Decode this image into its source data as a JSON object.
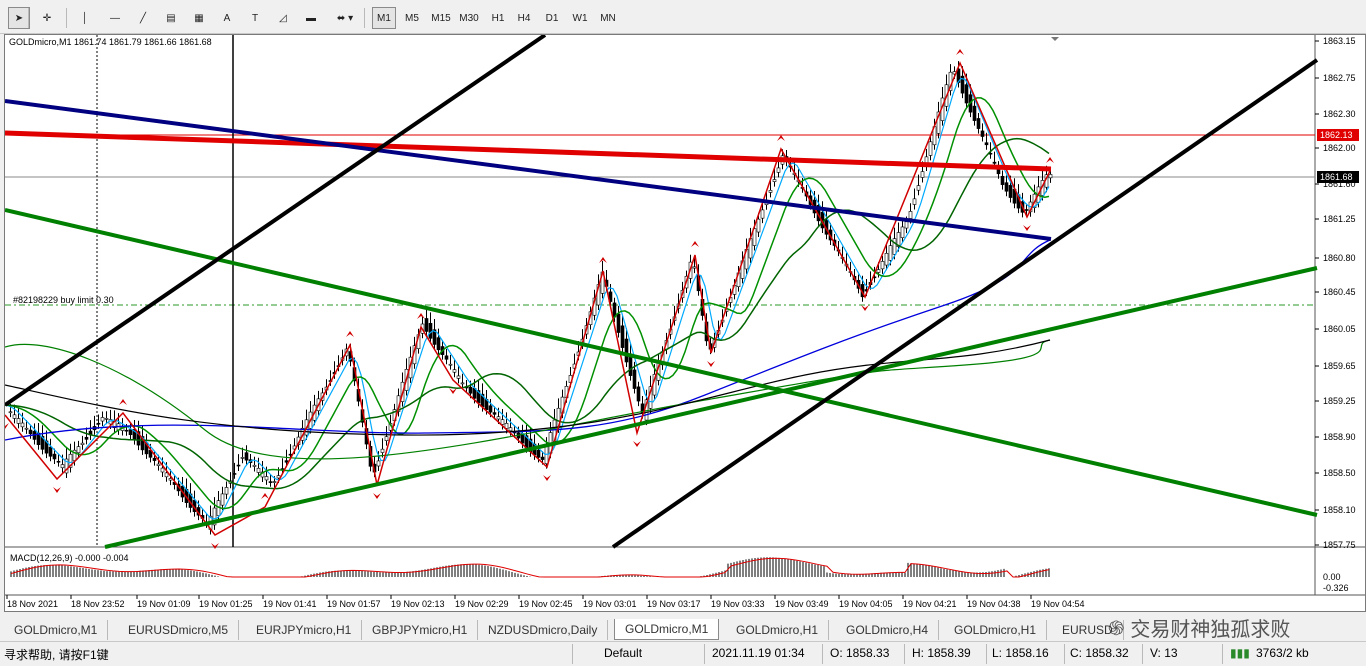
{
  "toolbar": {
    "tools": [
      {
        "name": "cursor-icon",
        "glyph": "➤"
      },
      {
        "name": "crosshair-icon",
        "glyph": "✛"
      },
      {
        "name": "vertical-line-icon",
        "glyph": "│"
      },
      {
        "name": "horizontal-line-icon",
        "glyph": "—"
      },
      {
        "name": "trendline-icon",
        "glyph": "╱"
      },
      {
        "name": "fibonacci-icon",
        "glyph": "▤"
      },
      {
        "name": "grid-tool-icon",
        "glyph": "▦"
      },
      {
        "name": "text-icon",
        "glyph": "A"
      },
      {
        "name": "text-label-icon",
        "glyph": "T"
      },
      {
        "name": "shapes-icon",
        "glyph": "◿"
      },
      {
        "name": "rectangle-icon",
        "glyph": "▬"
      },
      {
        "name": "arrows-icon",
        "glyph": "⬌"
      }
    ],
    "timeframes": [
      "M1",
      "M5",
      "M15",
      "M30",
      "H1",
      "H4",
      "D1",
      "W1",
      "MN"
    ],
    "active_timeframe": "M1"
  },
  "chart": {
    "header": "GOLDmicro,M1  1861.74 1861.79 1861.66 1861.68",
    "order_label": "#82198229 buy limit 0.30",
    "macd_label": "MACD(12,26,9) -0.000 -0.004",
    "price_axis": [
      "1863.15",
      "1862.75",
      "1862.30",
      "1862.00",
      "1861.60",
      "1861.25",
      "1860.80",
      "1860.45",
      "1860.05",
      "1859.65",
      "1859.25",
      "1858.90",
      "1858.50",
      "1858.10",
      "1857.75"
    ],
    "price_tag_red": "1862.13",
    "price_tag_current": "1861.68",
    "macd_axis": [
      "0.00",
      "-0.326"
    ],
    "time_axis": [
      "18 Nov 2021",
      "18 Nov 23:52",
      "19 Nov 01:09",
      "19 Nov 01:25",
      "19 Nov 01:41",
      "19 Nov 01:57",
      "19 Nov 02:13",
      "19 Nov 02:29",
      "19 Nov 02:45",
      "19 Nov 03:01",
      "19 Nov 03:17",
      "19 Nov 03:33",
      "19 Nov 03:49",
      "19 Nov 04:05",
      "19 Nov 04:21",
      "19 Nov 04:38",
      "19 Nov 04:54"
    ],
    "colors": {
      "red_line": "#e00000",
      "navy_line": "#000080",
      "green_line": "#008000",
      "black_line": "#000000",
      "blue_ma": "#0000dd",
      "cyan_ma": "#00aaff",
      "zigzag": "#d00000"
    }
  },
  "tabs": [
    "GOLDmicro,M1",
    "EURUSDmicro,M5",
    "EURJPYmicro,H1",
    "GBPJPYmicro,H1",
    "NZDUSDmicro,Daily",
    "GOLDmicro,M1",
    "GOLDmicro,H1",
    "GOLDmicro,H4",
    "GOLDmicro,H1",
    "EURUSD"
  ],
  "active_tab_index": 5,
  "watermark": "交易财神独孤求败",
  "status": {
    "help": "寻求帮助, 请按F1键",
    "profile": "Default",
    "datetime": "2021.11.19 01:34",
    "open": "O: 1858.33",
    "high": "H: 1858.39",
    "low": "L: 1858.16",
    "close": "C: 1858.32",
    "volume": "V: 13",
    "traffic": "3763/2 kb"
  }
}
